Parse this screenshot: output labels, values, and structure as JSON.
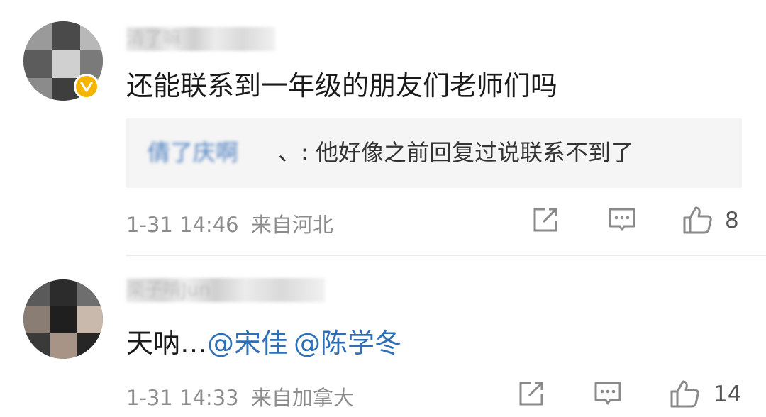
{
  "comments": [
    {
      "username": "清了嘛",
      "content": "还能联系到一年级的朋友们老师们吗",
      "verified": true,
      "reply": {
        "author": "倩了庆啊",
        "separator": "、:",
        "text": "他好像之前回复过说联系不到了"
      },
      "time": "1-31 14:46",
      "location": "来自河北",
      "likes": "8"
    },
    {
      "username": "栗子啃Jun",
      "content": "天呐…",
      "mentions": [
        "@宋佳",
        "@陈学冬"
      ],
      "time": "1-31 14:33",
      "location": "来自加拿大",
      "likes": "14"
    }
  ],
  "icons": {
    "share": "share-square-arrow-icon",
    "comment": "comment-bubble-icon",
    "like": "thumbs-up-icon",
    "verified": "verified-v-badge-icon"
  },
  "colors": {
    "mention": "#2f6fb5",
    "reply_name": "#4d7fc0",
    "meta": "#8c8c8c",
    "verified_badge": "#f5b400",
    "reply_bg": "#f5f5f5"
  }
}
